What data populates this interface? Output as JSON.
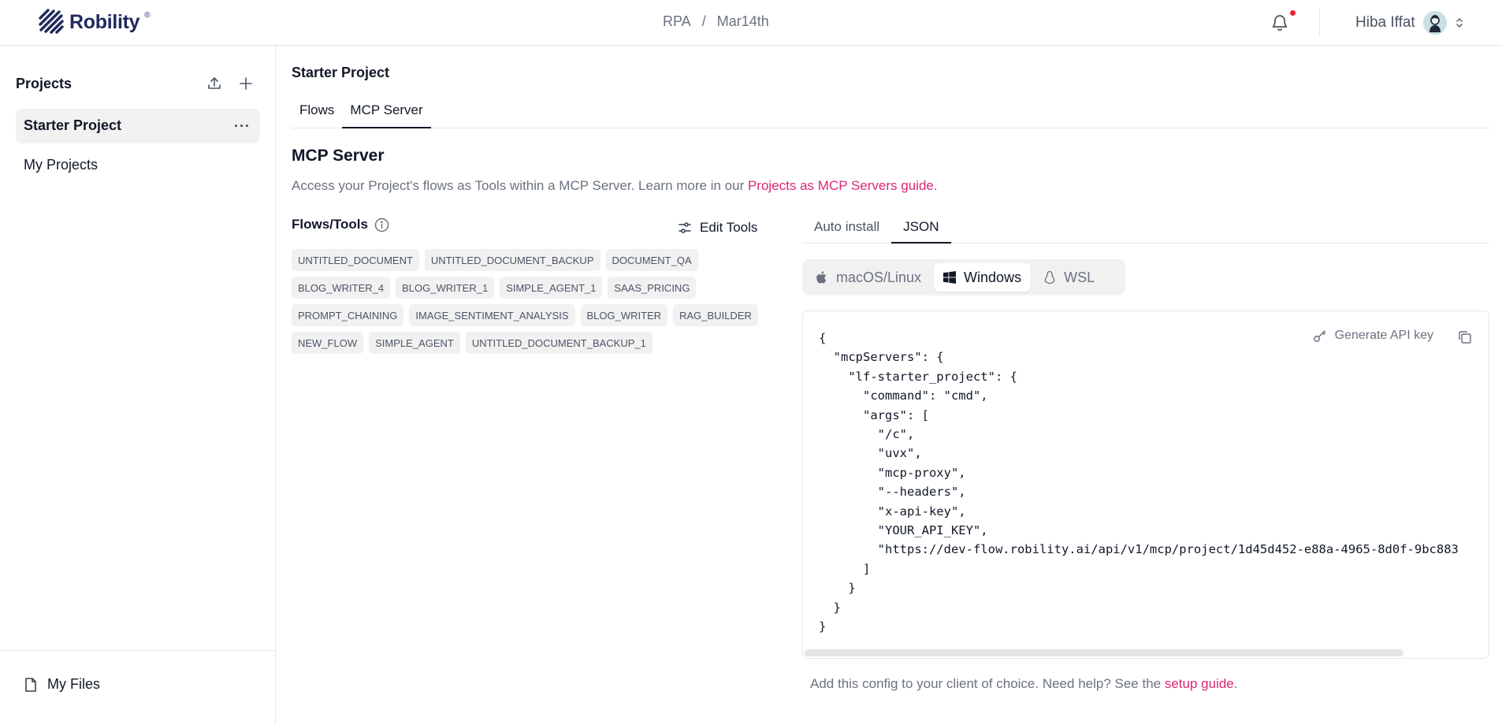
{
  "header": {
    "brand": "Robility",
    "brand_reg": "®",
    "breadcrumb": [
      "RPA",
      "/",
      "Mar14th"
    ],
    "user_name": "Hiba Iffat"
  },
  "sidebar": {
    "heading": "Projects",
    "items": [
      {
        "label": "Starter Project"
      },
      {
        "label": "My Projects"
      }
    ],
    "more": "···",
    "files_label": "My Files"
  },
  "main": {
    "title": "Starter Project",
    "tabs": [
      {
        "label": "Flows"
      },
      {
        "label": "MCP Server"
      }
    ],
    "section_title": "MCP Server",
    "description": "Access your Project's flows as Tools within a MCP Server. Learn more in our ",
    "description_link": "Projects as MCP Servers guide",
    "description_end": ".",
    "flows_tools_label": "Flows/Tools",
    "edit_tools_label": "Edit Tools",
    "chips": [
      "UNTITLED_DOCUMENT",
      "UNTITLED_DOCUMENT_BACKUP",
      "DOCUMENT_QA",
      "BLOG_WRITER_4",
      "BLOG_WRITER_1",
      "SIMPLE_AGENT_1",
      "SAAS_PRICING",
      "PROMPT_CHAINING",
      "IMAGE_SENTIMENT_ANALYSIS",
      "BLOG_WRITER",
      "RAG_BUILDER",
      "NEW_FLOW",
      "SIMPLE_AGENT",
      "UNTITLED_DOCUMENT_BACKUP_1"
    ],
    "install_tabs": [
      {
        "label": "Auto install"
      },
      {
        "label": "JSON"
      }
    ],
    "os_options": [
      {
        "label": "macOS/Linux"
      },
      {
        "label": "Windows"
      },
      {
        "label": "WSL"
      }
    ],
    "generate_key_label": "Generate API key",
    "code": "{\n  \"mcpServers\": {\n    \"lf-starter_project\": {\n      \"command\": \"cmd\",\n      \"args\": [\n        \"/c\",\n        \"uvx\",\n        \"mcp-proxy\",\n        \"--headers\",\n        \"x-api-key\",\n        \"YOUR_API_KEY\",\n        \"https://dev-flow.robility.ai/api/v1/mcp/project/1d45d452-e88a-4965-8d0f-9bc883\n      ]\n    }\n  }\n}",
    "footer_text": "Add this config to your client of choice. Need help? See the ",
    "footer_link": "setup guide",
    "footer_end": "."
  },
  "colors": {
    "link": "#db2777",
    "brand": "#1f2a5c",
    "notification_dot": "#ef1f3a"
  }
}
